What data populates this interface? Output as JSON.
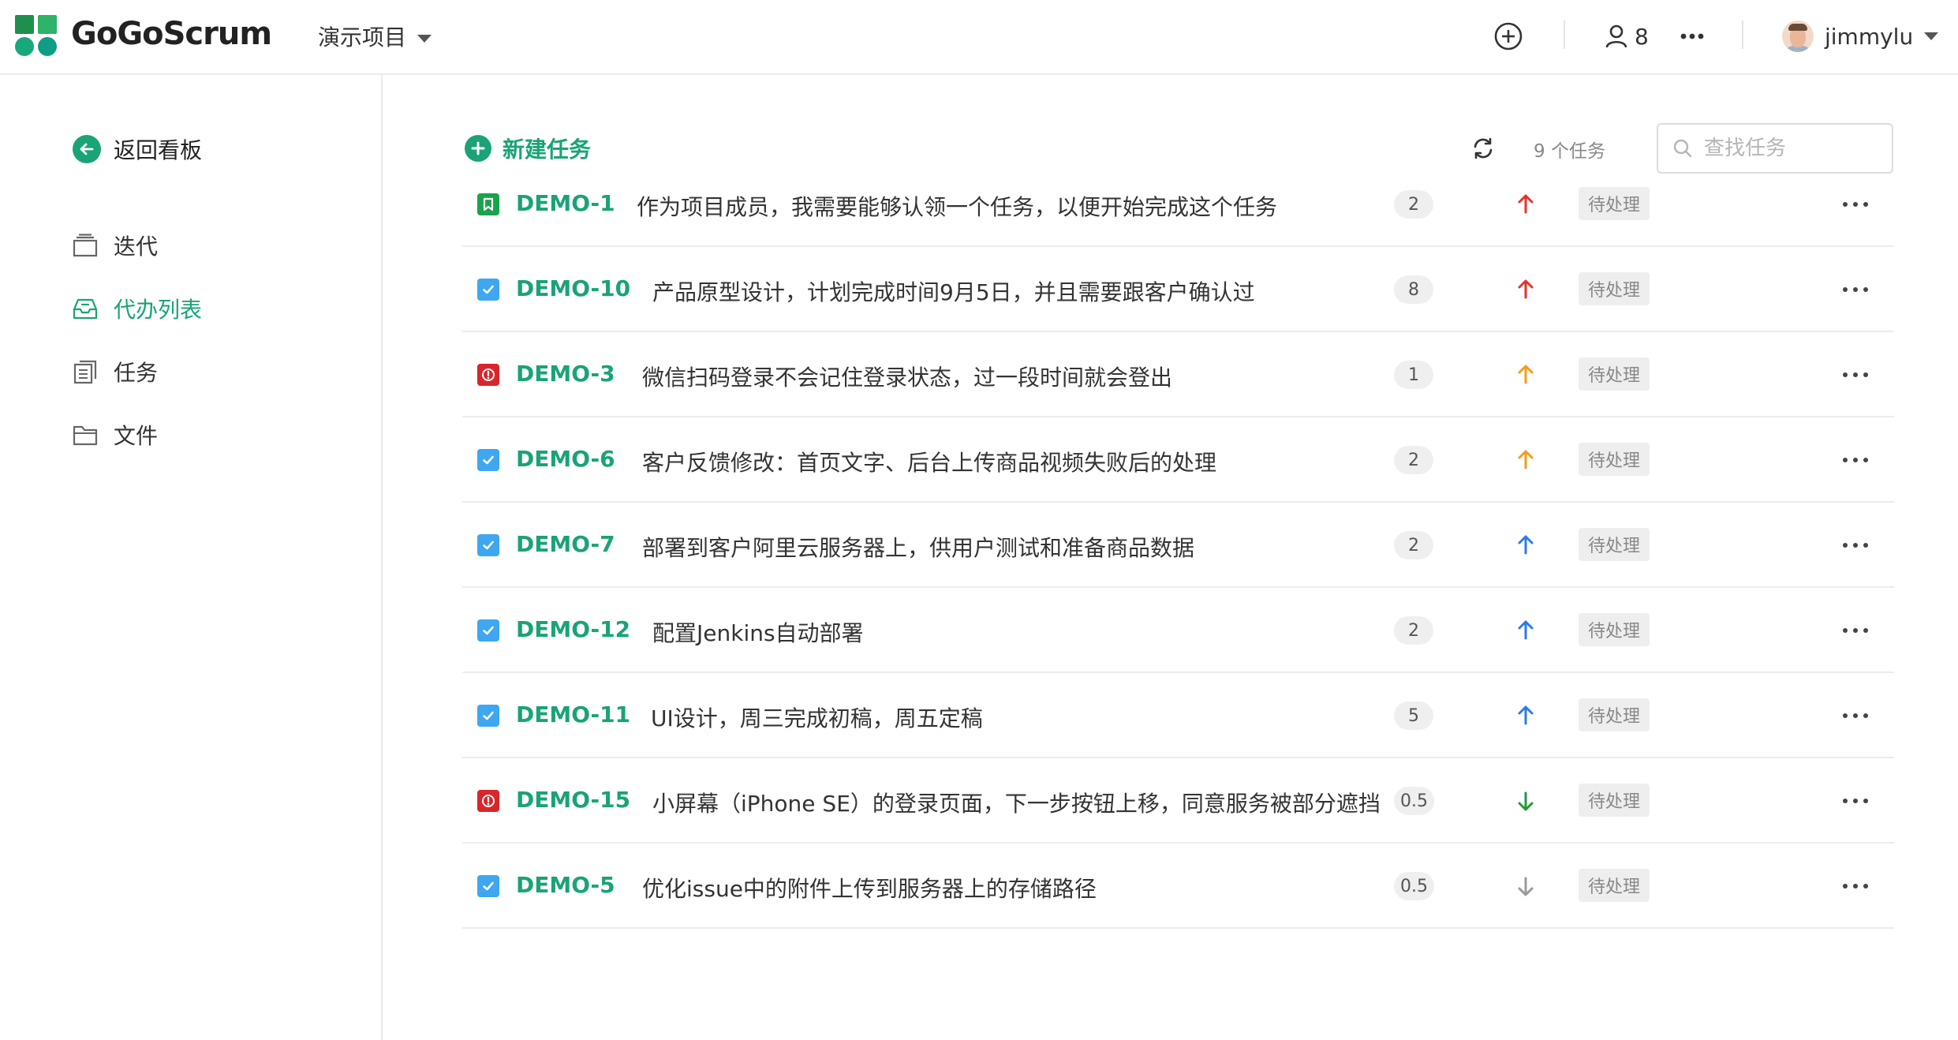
{
  "header": {
    "brand": "GoGoScrum",
    "project": "演示项目",
    "member_count": "8",
    "username": "jimmylu",
    "logo_colors": [
      "#1f8f4e",
      "#2db36a",
      "#17a97d",
      "#0e9e86"
    ]
  },
  "sidebar": {
    "back_label": "返回看板",
    "items": [
      {
        "label": "迭代",
        "icon": "sprint-icon",
        "active": false
      },
      {
        "label": "代办列表",
        "icon": "inbox-icon",
        "active": true
      },
      {
        "label": "任务",
        "icon": "tasks-icon",
        "active": false
      },
      {
        "label": "文件",
        "icon": "folder-icon",
        "active": false
      }
    ]
  },
  "toolbar": {
    "new_task_label": "新建任务",
    "task_count": "9 个任务",
    "search_placeholder": "查找任务"
  },
  "colors": {
    "accent": "#1aa377",
    "story": "#1aa34a",
    "task": "#3ea7f0",
    "bug": "#d9262a",
    "prio_high": "#e5332a",
    "prio_medium": "#f39c19",
    "prio_normal": "#2b7be5",
    "prio_low": "#1f9a39",
    "prio_lowest": "#9a9a9a"
  },
  "tasks": [
    {
      "id": "DEMO-1",
      "title": "作为项目成员，我需要能够认领一个任务，以便开始完成这个任务",
      "type": "story",
      "points": "2",
      "priority": "high",
      "status": "待处理"
    },
    {
      "id": "DEMO-10",
      "title": "产品原型设计，计划完成时间9月5日，并且需要跟客户确认过",
      "type": "task",
      "points": "8",
      "priority": "high",
      "status": "待处理"
    },
    {
      "id": "DEMO-3",
      "title": "微信扫码登录不会记住登录状态，过一段时间就会登出",
      "type": "bug",
      "points": "1",
      "priority": "medium",
      "status": "待处理"
    },
    {
      "id": "DEMO-6",
      "title": "客户反馈修改：首页文字、后台上传商品视频失败后的处理",
      "type": "task",
      "points": "2",
      "priority": "medium",
      "status": "待处理"
    },
    {
      "id": "DEMO-7",
      "title": "部署到客户阿里云服务器上，供用户测试和准备商品数据",
      "type": "task",
      "points": "2",
      "priority": "normal",
      "status": "待处理"
    },
    {
      "id": "DEMO-12",
      "title": "配置Jenkins自动部署",
      "type": "task",
      "points": "2",
      "priority": "normal",
      "status": "待处理"
    },
    {
      "id": "DEMO-11",
      "title": "UI设计，周三完成初稿，周五定稿",
      "type": "task",
      "points": "5",
      "priority": "normal",
      "status": "待处理"
    },
    {
      "id": "DEMO-15",
      "title": "小屏幕（iPhone SE）的登录页面，下一步按钮上移，同意服务被部分遮挡",
      "type": "bug",
      "points": "0.5",
      "priority": "low",
      "status": "待处理"
    },
    {
      "id": "DEMO-5",
      "title": "优化issue中的附件上传到服务器上的存储路径",
      "type": "task",
      "points": "0.5",
      "priority": "lowest",
      "status": "待处理"
    }
  ]
}
